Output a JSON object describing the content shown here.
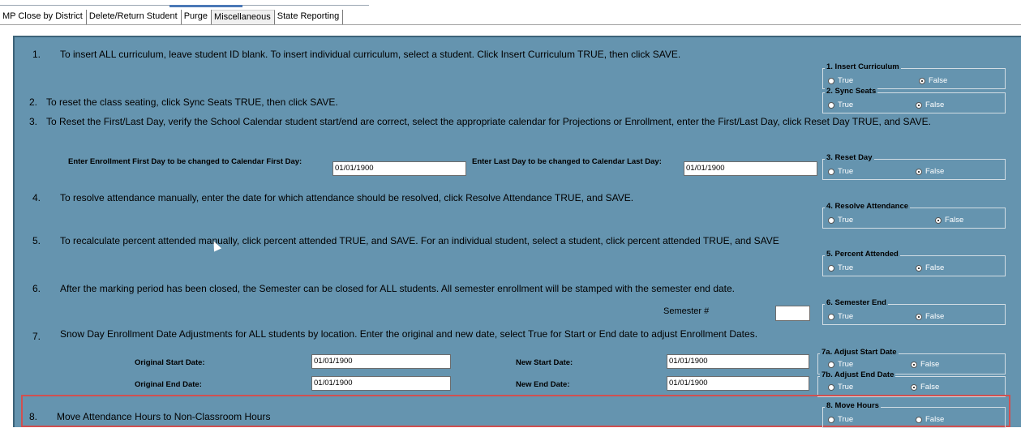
{
  "tabs": [
    {
      "label": "MP Close by District",
      "active": false
    },
    {
      "label": "Delete/Return Student",
      "active": false
    },
    {
      "label": "Purge",
      "active": false
    },
    {
      "label": "Miscellaneous",
      "active": true
    },
    {
      "label": "State Reporting",
      "active": false
    }
  ],
  "radio": {
    "true_label": "True",
    "false_label": "False"
  },
  "sections": {
    "s1": {
      "num": "1.",
      "text": "To insert ALL curriculum, leave student ID blank.  To insert individual curriculum, select a student.  Click Insert Curriculum TRUE, then click SAVE.",
      "group": "1. Insert Curriculum"
    },
    "s2": {
      "num": "2.",
      "text": "To reset the class seating, click Sync Seats TRUE, then click SAVE.",
      "group": "2. Sync Seats"
    },
    "s3": {
      "num": "3.",
      "text": "To Reset the First/Last Day, verify the School Calendar student start/end are correct, select the appropriate calendar for Projections or Enrollment, enter the First/Last Day, click Reset Day TRUE, and SAVE.",
      "first_label": "Enter Enrollment First Day to be changed to Calendar First Day:",
      "first_value": "01/01/1900",
      "last_label": "Enter Last Day to be changed to Calendar Last Day:",
      "last_value": "01/01/1900",
      "group": "3. Reset Day"
    },
    "s4": {
      "num": "4.",
      "text": "To resolve attendance manually, enter the date for which attendance should be resolved, click Resolve Attendance TRUE, and SAVE.",
      "group": "4. Resolve Attendance"
    },
    "s5": {
      "num": "5.",
      "text": "To recalculate percent attended manually, click percent attended TRUE, and SAVE. For an individual student, select a student, click percent attended TRUE, and SAVE",
      "group": "5. Percent Attended"
    },
    "s6": {
      "num": "6.",
      "text": "After the marking period has been closed, the Semester can be closed for ALL students.  All semester enrollment will be stamped with the semester end date.",
      "semester_label": "Semester #",
      "semester_value": "",
      "group": "6. Semester End"
    },
    "s7": {
      "num": "7.",
      "text": "Snow Day Enrollment Date Adjustments for ALL students by location.  Enter the original and new date, select True for Start or End date to adjust Enrollment Dates.",
      "orig_start_label": "Original Start Date:",
      "orig_start_value": "01/01/1900",
      "new_start_label": "New Start Date:",
      "new_start_value": "01/01/1900",
      "orig_end_label": "Original End Date:",
      "orig_end_value": "01/01/1900",
      "new_end_label": "New End Date:",
      "new_end_value": "01/01/1900",
      "group_a": "7a. Adjust Start Date",
      "group_b": "7b. Adjust End Date"
    },
    "s8": {
      "num": "8.",
      "text": "Move Attendance Hours to Non-Classroom Hours",
      "group": "8. Move Hours"
    }
  },
  "colors": {
    "panel": "#6594af",
    "highlight": "#d05050"
  }
}
